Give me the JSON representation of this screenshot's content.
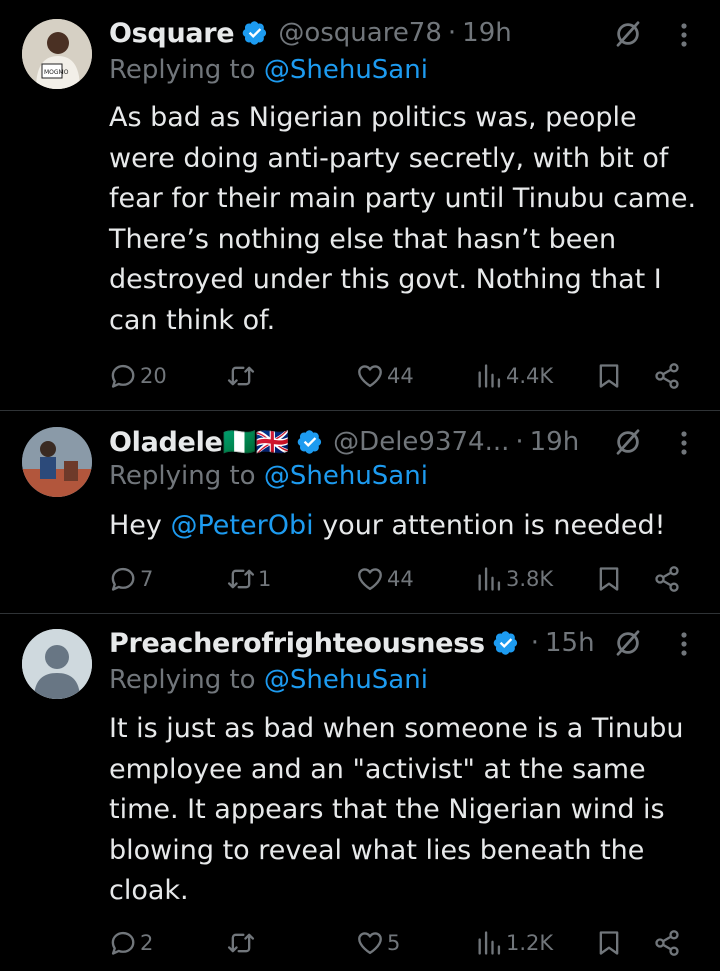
{
  "tweets": [
    {
      "name": "Osquare",
      "handle": "@osquare78",
      "time": "19h",
      "replying_prefix": "Replying to",
      "replying_to": "@ShehuSani",
      "text": "As bad as Nigerian politics was, people were doing anti-party secretly, with  bit of fear for their main party until Tinubu came. There’s nothing else that hasn’t been destroyed under this govt. Nothing that I can think of.",
      "replies": "20",
      "retweets": "",
      "likes": "44",
      "views": "4.4K"
    },
    {
      "name": "Oladele🇳🇬🇬🇧",
      "handle": "@Dele9374...",
      "time": "19h",
      "replying_prefix": "Replying to",
      "replying_to": "@ShehuSani",
      "text_prefix": "Hey ",
      "text_mention": "@PeterObi",
      "text_suffix": " your attention is needed!",
      "replies": "7",
      "retweets": "1",
      "likes": "44",
      "views": "3.8K"
    },
    {
      "name": "Preacherofrighteousness",
      "handle": "",
      "time": "15h",
      "replying_prefix": "Replying to",
      "replying_to": "@ShehuSani",
      "text": "It is just as bad when someone is a Tinubu employee and an \"activist\" at the same time. It appears that the Nigerian wind is blowing to reveal what lies beneath the cloak.",
      "replies": "2",
      "retweets": "",
      "likes": "5",
      "views": "1.2K"
    }
  ],
  "separator": "·",
  "colors": {
    "background": "#000000",
    "text": "#e7e9ea",
    "muted": "#71767b",
    "accent": "#1d9bf0",
    "divider": "#2f3336"
  },
  "icons": [
    "verified-badge-icon",
    "grok-icon",
    "more-icon",
    "reply-icon",
    "retweet-icon",
    "like-icon",
    "views-icon",
    "bookmark-icon",
    "share-icon"
  ]
}
